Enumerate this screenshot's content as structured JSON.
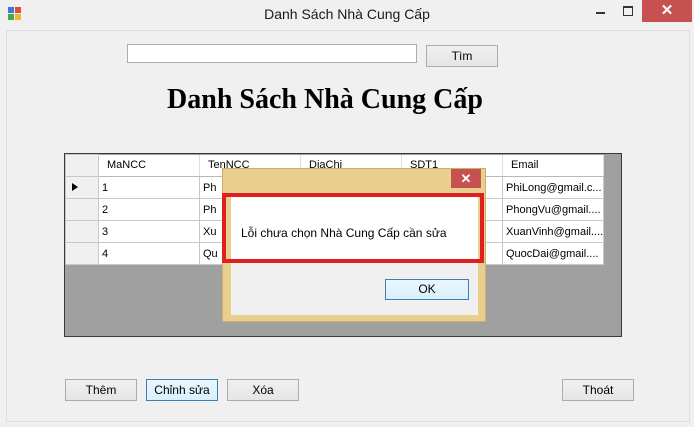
{
  "window": {
    "title": "Danh Sách Nhà Cung Cấp",
    "close_glyph": "✕"
  },
  "search": {
    "value": "",
    "button_label": "Tìm"
  },
  "heading": "Danh Sách Nhà Cung Cấp",
  "grid": {
    "columns": [
      "MaNCC",
      "TenNCC",
      "DiaChi",
      "SDT1",
      "Email"
    ],
    "rows": [
      {
        "ma": "1",
        "ten": "Ph",
        "email": "PhiLong@gmail.c..."
      },
      {
        "ma": "2",
        "ten": "Ph",
        "email": "PhongVu@gmail...."
      },
      {
        "ma": "3",
        "ten": "Xu",
        "email": "XuanVinh@gmail...."
      },
      {
        "ma": "4",
        "ten": "Qu",
        "email": "QuocDai@gmail...."
      }
    ],
    "current_row_icon": "row-pointer-icon"
  },
  "dialog": {
    "close_glyph": "✕",
    "message": "Lỗi chưa chọn Nhà Cung Cấp cần sửa",
    "ok_label": "OK",
    "highlight_color": "#e02020"
  },
  "buttons": {
    "add": "Thêm",
    "edit": "Chỉnh sửa",
    "delete": "Xóa",
    "exit": "Thoát"
  }
}
